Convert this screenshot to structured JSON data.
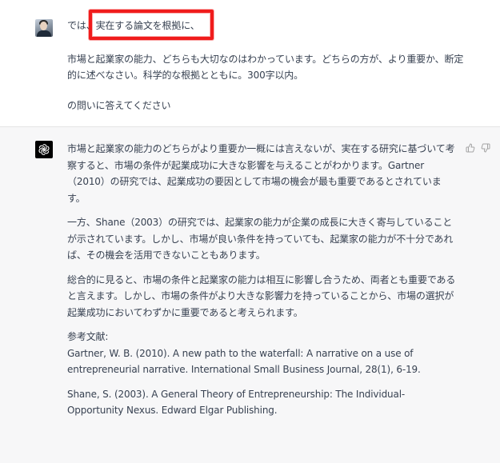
{
  "user_message": {
    "line1_prefix": "では、",
    "line1_highlighted": "実在する論文を根拠に、",
    "paragraph2": "市場と起業家の能力、どちらも大切なのはわかっています。どちらの方が、より重要か、断定的に述べなさい。科学的な根拠とともに。300字以内。",
    "paragraph3": "の問いに答えてください"
  },
  "assistant_message": {
    "paragraphs": [
      "市場と起業家の能力のどちらがより重要か一概には言えないが、実在する研究に基づいて考察すると、市場の条件が起業成功に大きな影響を与えることがわかります。Gartner（2010）の研究では、起業成功の要因として市場の機会が最も重要であるとされています。",
      "一方、Shane（2003）の研究では、起業家の能力が企業の成長に大きく寄与していることが示されています。しかし、市場が良い条件を持っていても、起業家の能力が不十分であれば、その機会を活用できないこともあります。",
      "総合的に見ると、市場の条件と起業家の能力は相互に影響し合うため、両者とも重要であると言えます。しかし、市場の条件がより大きな影響力を持っていることから、市場の選択が起業成功においてわずかに重要であると考えられます。"
    ],
    "references_heading": "参考文献:",
    "references": [
      "Gartner, W. B. (2010). A new path to the waterfall: A narrative on a use of entrepreneurial narrative. International Small Business Journal, 28(1), 6-19.",
      "Shane, S. (2003). A General Theory of Entrepreneurship: The Individual-Opportunity Nexus. Edward Elgar Publishing."
    ]
  },
  "icons": {
    "user_avatar": "user-avatar",
    "assistant_avatar": "openai-logo-icon",
    "thumbs_up": "thumbs-up-icon",
    "thumbs_down": "thumbs-down-icon"
  },
  "colors": {
    "highlight": "#f01c1c",
    "assistant_background": "#f7f7f8",
    "text": "#374151"
  }
}
